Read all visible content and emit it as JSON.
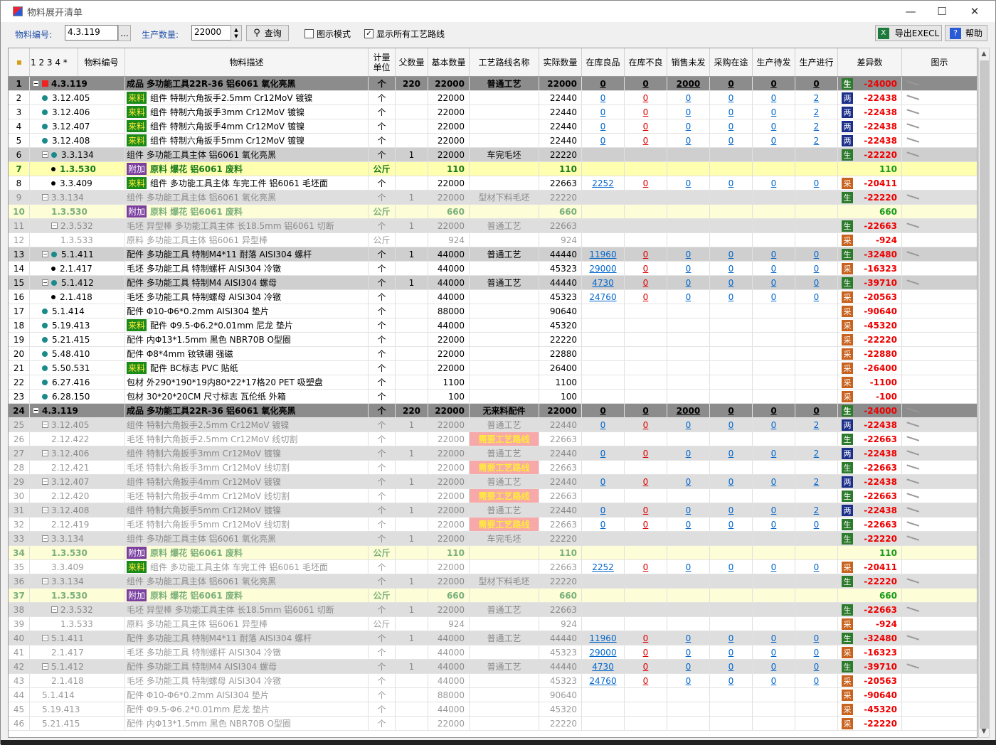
{
  "window": {
    "title": "物料展开清单"
  },
  "toolbar": {
    "material_label": "物料编号:",
    "material_value": "4.3.119",
    "browse_label": "...",
    "qty_label": "生产数量:",
    "qty_value": "22000",
    "query_label": "查询",
    "chart_mode_label": "图示模式",
    "chart_mode_checked": false,
    "show_routes_label": "显示所有工艺路线",
    "show_routes_checked": true,
    "export_label": "导出EXECL",
    "help_label": "帮助"
  },
  "header": {
    "levels": "1 2 3 4 *",
    "code": "物料编号",
    "desc": "物料描述",
    "unit": "计量\n单位",
    "parent_qty": "父数量",
    "base_qty": "基本数量",
    "route": "工艺路线名称",
    "actual_qty": "实际数量",
    "stock_good": "在库良品",
    "stock_bad": "在库不良",
    "sales_pending": "销售未发",
    "purchase_transit": "采购在途",
    "prod_wait": "生产待发",
    "prod_running": "生产进行",
    "diff": "差异数",
    "chart": "图示"
  },
  "rows": [
    {
      "n": "1",
      "code": "4.3.119",
      "tag": "",
      "desc": "成品 多功能工具22R-36 铝6061 氧化亮黑",
      "unit": "个",
      "pq": "220",
      "bq": "22000",
      "route": "普通工艺",
      "aq": "22000",
      "sg": "0",
      "sb": "0",
      "sp": "2000",
      "pt": "0",
      "pw": "0",
      "pr": "0",
      "bd": "生",
      "diff": "-24000",
      "style": "top",
      "lvl": 0,
      "icon": "exp"
    },
    {
      "n": "2",
      "code": "3.12.405",
      "tag": "来料",
      "desc": "组件 特制六角扳手2.5mm Cr12MoV 镀镍",
      "unit": "个",
      "pq": "",
      "bq": "22000",
      "route": "",
      "aq": "22440",
      "sg": "0",
      "sb": "0",
      "sp": "0",
      "pt": "0",
      "pw": "0",
      "pr": "2",
      "bd": "两",
      "diff": "-22438",
      "style": "",
      "lvl": 1,
      "icon": "dot"
    },
    {
      "n": "3",
      "code": "3.12.406",
      "tag": "来料",
      "desc": "组件 特制六角扳手3mm Cr12MoV 镀镍",
      "unit": "个",
      "pq": "",
      "bq": "22000",
      "route": "",
      "aq": "22440",
      "sg": "0",
      "sb": "0",
      "sp": "0",
      "pt": "0",
      "pw": "0",
      "pr": "2",
      "bd": "两",
      "diff": "-22438",
      "style": "",
      "lvl": 1,
      "icon": "dot"
    },
    {
      "n": "4",
      "code": "3.12.407",
      "tag": "来料",
      "desc": "组件 特制六角扳手4mm Cr12MoV 镀镍",
      "unit": "个",
      "pq": "",
      "bq": "22000",
      "route": "",
      "aq": "22440",
      "sg": "0",
      "sb": "0",
      "sp": "0",
      "pt": "0",
      "pw": "0",
      "pr": "2",
      "bd": "两",
      "diff": "-22438",
      "style": "",
      "lvl": 1,
      "icon": "dot"
    },
    {
      "n": "5",
      "code": "3.12.408",
      "tag": "来料",
      "desc": "组件 特制六角扳手5mm Cr12MoV 镀镍",
      "unit": "个",
      "pq": "",
      "bq": "22000",
      "route": "",
      "aq": "22440",
      "sg": "0",
      "sb": "0",
      "sp": "0",
      "pt": "0",
      "pw": "0",
      "pr": "2",
      "bd": "两",
      "diff": "-22438",
      "style": "",
      "lvl": 1,
      "icon": "dot"
    },
    {
      "n": "6",
      "code": "3.3.134",
      "tag": "",
      "desc": "组件 多功能工具主体 铝6061 氧化亮黑",
      "unit": "个",
      "pq": "1",
      "bq": "22000",
      "route": "车完毛坯",
      "aq": "22220",
      "sg": "",
      "sb": "",
      "sp": "",
      "pt": "",
      "pw": "",
      "pr": "",
      "bd": "生",
      "diff": "-22220",
      "style": "grp",
      "lvl": 1,
      "icon": "expdot"
    },
    {
      "n": "7",
      "code": "1.3.530",
      "tag": "附加",
      "desc": "原料 爆花 铝6061 废料",
      "unit": "公斤",
      "pq": "",
      "bq": "110",
      "route": "",
      "aq": "110",
      "sg": "",
      "sb": "",
      "sp": "",
      "pt": "",
      "pw": "",
      "pr": "",
      "bd": "",
      "diff": "110",
      "style": "yel",
      "lvl": 2,
      "icon": "dotb"
    },
    {
      "n": "8",
      "code": "3.3.409",
      "tag": "来料",
      "desc": "组件 多功能工具主体 车完工件 铝6061 毛坯面",
      "unit": "个",
      "pq": "",
      "bq": "22000",
      "route": "",
      "aq": "22663",
      "sg": "2252",
      "sb": "0",
      "sp": "0",
      "pt": "0",
      "pw": "0",
      "pr": "0",
      "bd": "采",
      "diff": "-20411",
      "style": "",
      "lvl": 2,
      "icon": "dotb"
    },
    {
      "n": "9",
      "code": "3.3.134",
      "tag": "",
      "desc": "组件 多功能工具主体 铝6061 氧化亮黑",
      "unit": "个",
      "pq": "1",
      "bq": "22000",
      "route": "型材下料毛坯",
      "aq": "22220",
      "sg": "",
      "sb": "",
      "sp": "",
      "pt": "",
      "pw": "",
      "pr": "",
      "bd": "生",
      "diff": "-22220",
      "style": "dimgrp",
      "lvl": 1,
      "icon": "exp"
    },
    {
      "n": "10",
      "code": "1.3.530",
      "tag": "附加",
      "desc": "原料 爆花 铝6061 废料",
      "unit": "公斤",
      "pq": "",
      "bq": "660",
      "route": "",
      "aq": "660",
      "sg": "",
      "sb": "",
      "sp": "",
      "pt": "",
      "pw": "",
      "pr": "",
      "bd": "",
      "diff": "660",
      "style": "yel2",
      "lvl": 2,
      "icon": ""
    },
    {
      "n": "11",
      "code": "2.3.532",
      "tag": "",
      "desc": "毛坯 异型棒 多功能工具主体 长18.5mm 铝6061 切断",
      "unit": "个",
      "pq": "1",
      "bq": "22000",
      "route": "普通工艺",
      "aq": "22663",
      "sg": "",
      "sb": "",
      "sp": "",
      "pt": "",
      "pw": "",
      "pr": "",
      "bd": "生",
      "diff": "-22663",
      "style": "dimgrp",
      "lvl": 2,
      "icon": "exp"
    },
    {
      "n": "12",
      "code": "1.3.533",
      "tag": "",
      "desc": "原料 多功能工具主体 铝6061 异型棒",
      "unit": "公斤",
      "pq": "",
      "bq": "924",
      "route": "",
      "aq": "924",
      "sg": "",
      "sb": "",
      "sp": "",
      "pt": "",
      "pw": "",
      "pr": "",
      "bd": "采",
      "diff": "-924",
      "style": "dim",
      "lvl": 3,
      "icon": ""
    },
    {
      "n": "13",
      "code": "5.1.411",
      "tag": "",
      "desc": "配件 多功能工具 特制M4*11 耐落 AISI304 螺杆",
      "unit": "个",
      "pq": "1",
      "bq": "44000",
      "route": "普通工艺",
      "aq": "44440",
      "sg": "11960",
      "sb": "0",
      "sp": "0",
      "pt": "0",
      "pw": "0",
      "pr": "0",
      "bd": "生",
      "diff": "-32480",
      "style": "grp",
      "lvl": 1,
      "icon": "expdot"
    },
    {
      "n": "14",
      "code": "2.1.417",
      "tag": "",
      "desc": "毛坯 多功能工具 特制螺杆 AISI304 冷镦",
      "unit": "个",
      "pq": "",
      "bq": "44000",
      "route": "",
      "aq": "45323",
      "sg": "29000",
      "sb": "0",
      "sp": "0",
      "pt": "0",
      "pw": "0",
      "pr": "0",
      "bd": "采",
      "diff": "-16323",
      "style": "",
      "lvl": 2,
      "icon": "dotb"
    },
    {
      "n": "15",
      "code": "5.1.412",
      "tag": "",
      "desc": "配件 多功能工具 特制M4 AISI304 螺母",
      "unit": "个",
      "pq": "1",
      "bq": "44000",
      "route": "普通工艺",
      "aq": "44440",
      "sg": "4730",
      "sb": "0",
      "sp": "0",
      "pt": "0",
      "pw": "0",
      "pr": "0",
      "bd": "生",
      "diff": "-39710",
      "style": "grp",
      "lvl": 1,
      "icon": "expdot"
    },
    {
      "n": "16",
      "code": "2.1.418",
      "tag": "",
      "desc": "毛坯 多功能工具 特制螺母 AISI304 冷镦",
      "unit": "个",
      "pq": "",
      "bq": "44000",
      "route": "",
      "aq": "45323",
      "sg": "24760",
      "sb": "0",
      "sp": "0",
      "pt": "0",
      "pw": "0",
      "pr": "0",
      "bd": "采",
      "diff": "-20563",
      "style": "",
      "lvl": 2,
      "icon": "dotb"
    },
    {
      "n": "17",
      "code": "5.1.414",
      "tag": "",
      "desc": "配件 Φ10-Φ6*0.2mm AISI304 垫片",
      "unit": "个",
      "pq": "",
      "bq": "88000",
      "route": "",
      "aq": "90640",
      "sg": "",
      "sb": "",
      "sp": "",
      "pt": "",
      "pw": "",
      "pr": "",
      "bd": "采",
      "diff": "-90640",
      "style": "",
      "lvl": 1,
      "icon": "dot"
    },
    {
      "n": "18",
      "code": "5.19.413",
      "tag": "来料",
      "desc": "配件 Φ9.5-Φ6.2*0.01mm 尼龙 垫片",
      "unit": "个",
      "pq": "",
      "bq": "44000",
      "route": "",
      "aq": "45320",
      "sg": "",
      "sb": "",
      "sp": "",
      "pt": "",
      "pw": "",
      "pr": "",
      "bd": "采",
      "diff": "-45320",
      "style": "",
      "lvl": 1,
      "icon": "dot"
    },
    {
      "n": "19",
      "code": "5.21.415",
      "tag": "",
      "desc": "配件 内Φ13*1.5mm 黑色 NBR70B O型圈",
      "unit": "个",
      "pq": "",
      "bq": "22000",
      "route": "",
      "aq": "22220",
      "sg": "",
      "sb": "",
      "sp": "",
      "pt": "",
      "pw": "",
      "pr": "",
      "bd": "采",
      "diff": "-22220",
      "style": "",
      "lvl": 1,
      "icon": "dot"
    },
    {
      "n": "20",
      "code": "5.48.410",
      "tag": "",
      "desc": "配件 Φ8*4mm 钕铁硼 强磁",
      "unit": "个",
      "pq": "",
      "bq": "22000",
      "route": "",
      "aq": "22880",
      "sg": "",
      "sb": "",
      "sp": "",
      "pt": "",
      "pw": "",
      "pr": "",
      "bd": "采",
      "diff": "-22880",
      "style": "",
      "lvl": 1,
      "icon": "dot"
    },
    {
      "n": "21",
      "code": "5.50.531",
      "tag": "来料",
      "desc": "配件 BC标志 PVC 贴纸",
      "unit": "个",
      "pq": "",
      "bq": "22000",
      "route": "",
      "aq": "26400",
      "sg": "",
      "sb": "",
      "sp": "",
      "pt": "",
      "pw": "",
      "pr": "",
      "bd": "采",
      "diff": "-26400",
      "style": "",
      "lvl": 1,
      "icon": "dot"
    },
    {
      "n": "22",
      "code": "6.27.416",
      "tag": "",
      "desc": "包材 外290*190*19内80*22*17格20 PET 吸塑盘",
      "unit": "个",
      "pq": "",
      "bq": "1100",
      "route": "",
      "aq": "1100",
      "sg": "",
      "sb": "",
      "sp": "",
      "pt": "",
      "pw": "",
      "pr": "",
      "bd": "采",
      "diff": "-1100",
      "style": "",
      "lvl": 1,
      "icon": "dot"
    },
    {
      "n": "23",
      "code": "6.28.150",
      "tag": "",
      "desc": "包材 30*20*20CM 尺寸标志 瓦伦纸 外箱",
      "unit": "个",
      "pq": "",
      "bq": "100",
      "route": "",
      "aq": "100",
      "sg": "",
      "sb": "",
      "sp": "",
      "pt": "",
      "pw": "",
      "pr": "",
      "bd": "采",
      "diff": "-100",
      "style": "",
      "lvl": 1,
      "icon": "dot"
    },
    {
      "n": "24",
      "code": "4.3.119",
      "tag": "",
      "desc": "成品 多功能工具22R-36 铝6061 氧化亮黑",
      "unit": "个",
      "pq": "220",
      "bq": "22000",
      "route": "无来料配件",
      "aq": "22000",
      "sg": "0",
      "sb": "0",
      "sp": "2000",
      "pt": "0",
      "pw": "0",
      "pr": "0",
      "bd": "生",
      "diff": "-24000",
      "style": "top",
      "lvl": 0,
      "icon": "exp"
    },
    {
      "n": "25",
      "code": "3.12.405",
      "tag": "",
      "desc": "组件 特制六角扳手2.5mm Cr12MoV 镀镍",
      "unit": "个",
      "pq": "1",
      "bq": "22000",
      "route": "普通工艺",
      "aq": "22440",
      "sg": "0",
      "sb": "0",
      "sp": "0",
      "pt": "0",
      "pw": "0",
      "pr": "2",
      "bd": "两",
      "diff": "-22438",
      "style": "dimgrp",
      "lvl": 1,
      "icon": "exp"
    },
    {
      "n": "26",
      "code": "2.12.422",
      "tag": "",
      "desc": "毛坯 特制六角扳手2.5mm Cr12MoV 线切割",
      "unit": "个",
      "pq": "",
      "bq": "22000",
      "route": "需要工艺路线",
      "aq": "22663",
      "sg": "",
      "sb": "",
      "sp": "",
      "pt": "",
      "pw": "",
      "pr": "",
      "bd": "生",
      "diff": "-22663",
      "style": "dim",
      "lvl": 2,
      "icon": ""
    },
    {
      "n": "27",
      "code": "3.12.406",
      "tag": "",
      "desc": "组件 特制六角扳手3mm Cr12MoV 镀镍",
      "unit": "个",
      "pq": "1",
      "bq": "22000",
      "route": "普通工艺",
      "aq": "22440",
      "sg": "0",
      "sb": "0",
      "sp": "0",
      "pt": "0",
      "pw": "0",
      "pr": "2",
      "bd": "两",
      "diff": "-22438",
      "style": "dimgrp",
      "lvl": 1,
      "icon": "exp"
    },
    {
      "n": "28",
      "code": "2.12.421",
      "tag": "",
      "desc": "毛坯 特制六角扳手3mm Cr12MoV 线切割",
      "unit": "个",
      "pq": "",
      "bq": "22000",
      "route": "需要工艺路线",
      "aq": "22663",
      "sg": "",
      "sb": "",
      "sp": "",
      "pt": "",
      "pw": "",
      "pr": "",
      "bd": "生",
      "diff": "-22663",
      "style": "dim",
      "lvl": 2,
      "icon": ""
    },
    {
      "n": "29",
      "code": "3.12.407",
      "tag": "",
      "desc": "组件 特制六角扳手4mm Cr12MoV 镀镍",
      "unit": "个",
      "pq": "1",
      "bq": "22000",
      "route": "普通工艺",
      "aq": "22440",
      "sg": "0",
      "sb": "0",
      "sp": "0",
      "pt": "0",
      "pw": "0",
      "pr": "2",
      "bd": "两",
      "diff": "-22438",
      "style": "dimgrp",
      "lvl": 1,
      "icon": "exp"
    },
    {
      "n": "30",
      "code": "2.12.420",
      "tag": "",
      "desc": "毛坯 特制六角扳手4mm Cr12MoV 线切割",
      "unit": "个",
      "pq": "",
      "bq": "22000",
      "route": "需要工艺路线",
      "aq": "22663",
      "sg": "",
      "sb": "",
      "sp": "",
      "pt": "",
      "pw": "",
      "pr": "",
      "bd": "生",
      "diff": "-22663",
      "style": "dim",
      "lvl": 2,
      "icon": ""
    },
    {
      "n": "31",
      "code": "3.12.408",
      "tag": "",
      "desc": "组件 特制六角扳手5mm Cr12MoV 镀镍",
      "unit": "个",
      "pq": "1",
      "bq": "22000",
      "route": "普通工艺",
      "aq": "22440",
      "sg": "0",
      "sb": "0",
      "sp": "0",
      "pt": "0",
      "pw": "0",
      "pr": "2",
      "bd": "两",
      "diff": "-22438",
      "style": "dimgrp",
      "lvl": 1,
      "icon": "exp"
    },
    {
      "n": "32",
      "code": "2.12.419",
      "tag": "",
      "desc": "毛坯 特制六角扳手5mm Cr12MoV 线切割",
      "unit": "个",
      "pq": "",
      "bq": "22000",
      "route": "需要工艺路线",
      "aq": "22663",
      "sg": "0",
      "sb": "0",
      "sp": "0",
      "pt": "0",
      "pw": "0",
      "pr": "0",
      "bd": "生",
      "diff": "-22663",
      "style": "dim",
      "lvl": 2,
      "icon": ""
    },
    {
      "n": "33",
      "code": "3.3.134",
      "tag": "",
      "desc": "组件 多功能工具主体 铝6061 氧化亮黑",
      "unit": "个",
      "pq": "1",
      "bq": "22000",
      "route": "车完毛坯",
      "aq": "22220",
      "sg": "",
      "sb": "",
      "sp": "",
      "pt": "",
      "pw": "",
      "pr": "",
      "bd": "生",
      "diff": "-22220",
      "style": "dimgrp",
      "lvl": 1,
      "icon": "exp"
    },
    {
      "n": "34",
      "code": "1.3.530",
      "tag": "附加",
      "desc": "原料 爆花 铝6061 废料",
      "unit": "公斤",
      "pq": "",
      "bq": "110",
      "route": "",
      "aq": "110",
      "sg": "",
      "sb": "",
      "sp": "",
      "pt": "",
      "pw": "",
      "pr": "",
      "bd": "",
      "diff": "110",
      "style": "yel2",
      "lvl": 2,
      "icon": ""
    },
    {
      "n": "35",
      "code": "3.3.409",
      "tag": "来料",
      "desc": "组件 多功能工具主体 车完工件 铝6061 毛坯面",
      "unit": "个",
      "pq": "",
      "bq": "22000",
      "route": "",
      "aq": "22663",
      "sg": "2252",
      "sb": "0",
      "sp": "0",
      "pt": "0",
      "pw": "0",
      "pr": "0",
      "bd": "采",
      "diff": "-20411",
      "style": "dim",
      "lvl": 2,
      "icon": ""
    },
    {
      "n": "36",
      "code": "3.3.134",
      "tag": "",
      "desc": "组件 多功能工具主体 铝6061 氧化亮黑",
      "unit": "个",
      "pq": "1",
      "bq": "22000",
      "route": "型材下料毛坯",
      "aq": "22220",
      "sg": "",
      "sb": "",
      "sp": "",
      "pt": "",
      "pw": "",
      "pr": "",
      "bd": "生",
      "diff": "-22220",
      "style": "dimgrp",
      "lvl": 1,
      "icon": "exp"
    },
    {
      "n": "37",
      "code": "1.3.530",
      "tag": "附加",
      "desc": "原料 爆花 铝6061 废料",
      "unit": "公斤",
      "pq": "",
      "bq": "660",
      "route": "",
      "aq": "660",
      "sg": "",
      "sb": "",
      "sp": "",
      "pt": "",
      "pw": "",
      "pr": "",
      "bd": "",
      "diff": "660",
      "style": "yel2",
      "lvl": 2,
      "icon": ""
    },
    {
      "n": "38",
      "code": "2.3.532",
      "tag": "",
      "desc": "毛坯 异型棒 多功能工具主体 长18.5mm 铝6061 切断",
      "unit": "个",
      "pq": "1",
      "bq": "22000",
      "route": "普通工艺",
      "aq": "22663",
      "sg": "",
      "sb": "",
      "sp": "",
      "pt": "",
      "pw": "",
      "pr": "",
      "bd": "生",
      "diff": "-22663",
      "style": "dimgrp",
      "lvl": 2,
      "icon": "exp"
    },
    {
      "n": "39",
      "code": "1.3.533",
      "tag": "",
      "desc": "原料 多功能工具主体 铝6061 异型棒",
      "unit": "公斤",
      "pq": "",
      "bq": "924",
      "route": "",
      "aq": "924",
      "sg": "",
      "sb": "",
      "sp": "",
      "pt": "",
      "pw": "",
      "pr": "",
      "bd": "采",
      "diff": "-924",
      "style": "dim",
      "lvl": 3,
      "icon": ""
    },
    {
      "n": "40",
      "code": "5.1.411",
      "tag": "",
      "desc": "配件 多功能工具 特制M4*11 耐落 AISI304 螺杆",
      "unit": "个",
      "pq": "1",
      "bq": "44000",
      "route": "普通工艺",
      "aq": "44440",
      "sg": "11960",
      "sb": "0",
      "sp": "0",
      "pt": "0",
      "pw": "0",
      "pr": "0",
      "bd": "生",
      "diff": "-32480",
      "style": "dimgrp",
      "lvl": 1,
      "icon": "exp"
    },
    {
      "n": "41",
      "code": "2.1.417",
      "tag": "",
      "desc": "毛坯 多功能工具 特制螺杆 AISI304 冷镦",
      "unit": "个",
      "pq": "",
      "bq": "44000",
      "route": "",
      "aq": "45323",
      "sg": "29000",
      "sb": "0",
      "sp": "0",
      "pt": "0",
      "pw": "0",
      "pr": "0",
      "bd": "采",
      "diff": "-16323",
      "style": "dim",
      "lvl": 2,
      "icon": ""
    },
    {
      "n": "42",
      "code": "5.1.412",
      "tag": "",
      "desc": "配件 多功能工具 特制M4 AISI304 螺母",
      "unit": "个",
      "pq": "1",
      "bq": "44000",
      "route": "普通工艺",
      "aq": "44440",
      "sg": "4730",
      "sb": "0",
      "sp": "0",
      "pt": "0",
      "pw": "0",
      "pr": "0",
      "bd": "生",
      "diff": "-39710",
      "style": "dimgrp",
      "lvl": 1,
      "icon": "exp"
    },
    {
      "n": "43",
      "code": "2.1.418",
      "tag": "",
      "desc": "毛坯 多功能工具 特制螺母 AISI304 冷镦",
      "unit": "个",
      "pq": "",
      "bq": "44000",
      "route": "",
      "aq": "45323",
      "sg": "24760",
      "sb": "0",
      "sp": "0",
      "pt": "0",
      "pw": "0",
      "pr": "0",
      "bd": "采",
      "diff": "-20563",
      "style": "dim",
      "lvl": 2,
      "icon": ""
    },
    {
      "n": "44",
      "code": "5.1.414",
      "tag": "",
      "desc": "配件 Φ10-Φ6*0.2mm AISI304 垫片",
      "unit": "个",
      "pq": "",
      "bq": "88000",
      "route": "",
      "aq": "90640",
      "sg": "",
      "sb": "",
      "sp": "",
      "pt": "",
      "pw": "",
      "pr": "",
      "bd": "采",
      "diff": "-90640",
      "style": "dim",
      "lvl": 1,
      "icon": ""
    },
    {
      "n": "45",
      "code": "5.19.413",
      "tag": "",
      "desc": "配件 Φ9.5-Φ6.2*0.01mm 尼龙 垫片",
      "unit": "个",
      "pq": "",
      "bq": "44000",
      "route": "",
      "aq": "45320",
      "sg": "",
      "sb": "",
      "sp": "",
      "pt": "",
      "pw": "",
      "pr": "",
      "bd": "采",
      "diff": "-45320",
      "style": "dim",
      "lvl": 1,
      "icon": ""
    },
    {
      "n": "46",
      "code": "5.21.415",
      "tag": "",
      "desc": "配件 内Φ13*1.5mm 黑色 NBR70B O型圈",
      "unit": "个",
      "pq": "",
      "bq": "22000",
      "route": "",
      "aq": "22220",
      "sg": "",
      "sb": "",
      "sp": "",
      "pt": "",
      "pw": "",
      "pr": "",
      "bd": "采",
      "diff": "-22220",
      "style": "dim",
      "lvl": 1,
      "icon": ""
    }
  ]
}
